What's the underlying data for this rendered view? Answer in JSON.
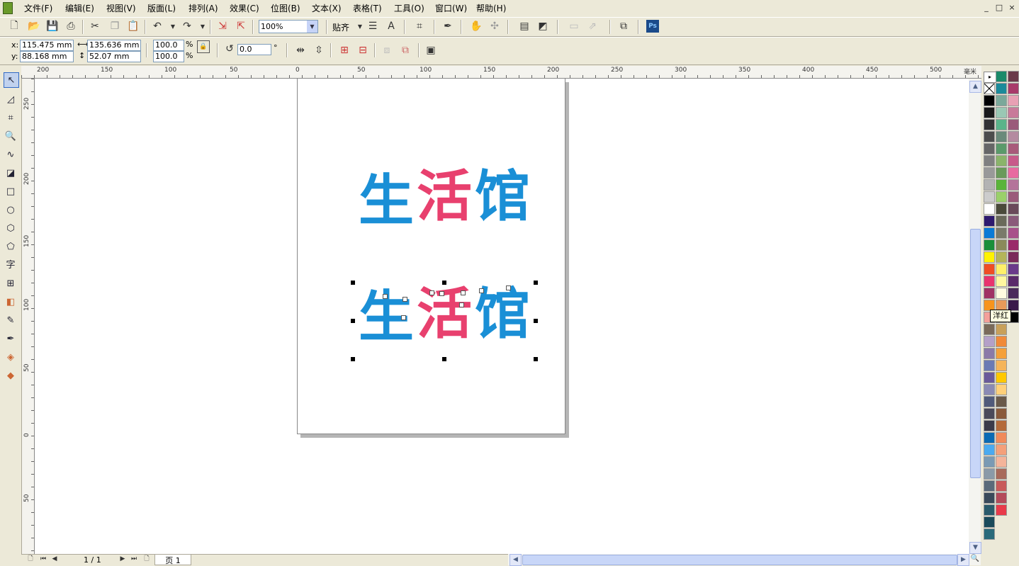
{
  "menu": [
    "文件(F)",
    "编辑(E)",
    "视图(V)",
    "版面(L)",
    "排列(A)",
    "效果(C)",
    "位图(B)",
    "文本(X)",
    "表格(T)",
    "工具(O)",
    "窗口(W)",
    "帮助(H)"
  ],
  "window_buttons": [
    "_",
    "□",
    "×"
  ],
  "standard_toolbar": {
    "zoom_value": "100%",
    "snap_label": "贴齐",
    "ps_label": "Ps"
  },
  "property_bar": {
    "x_label": "x:",
    "x_value": "115.475 mm",
    "y_label": "y:",
    "y_value": "88.168 mm",
    "width_value": "135.636 mm",
    "height_value": "52.07 mm",
    "scale_x": "100.0",
    "scale_y": "100.0",
    "percent": "%",
    "rotation": "0.0",
    "degree": "°"
  },
  "ruler": {
    "unit": "毫米",
    "h_labels": [
      "200",
      "150",
      "100",
      "50",
      "0",
      "50",
      "100",
      "150",
      "200",
      "250",
      "300",
      "350",
      "400",
      "450",
      "500"
    ],
    "v_labels": [
      "250",
      "200",
      "150",
      "100",
      "50",
      "0",
      "50"
    ]
  },
  "artwork": {
    "logo_text": "生活馆",
    "char1": "生",
    "char2": "活",
    "char3": "馆",
    "blue": "#1a8fd6",
    "pink": "#e8406e"
  },
  "page_nav": {
    "counter": "1 / 1",
    "page_tab": "页 1"
  },
  "palette": {
    "tooltip": "洋红",
    "col1": [
      "#000000",
      "#1a1a1a",
      "#333333",
      "#4d4d4d",
      "#666666",
      "#808080",
      "#999999",
      "#b3b3b3",
      "#cccccc",
      "#ffffff",
      "#2e1a6e",
      "#0a7ad6",
      "#1a8f3a",
      "#fff200",
      "#f04e23",
      "#e8346e",
      "#a03264",
      "#f7941d",
      "#f4a09a",
      "#7a6a5a",
      "#b4a0c8",
      "#8a7aa8",
      "#6a7ab4",
      "#6a5a9a",
      "#8a8ab4",
      "#505a7a",
      "#4a4a5a",
      "#3a3a4a",
      "#0a6ab4",
      "#4aaaf0",
      "#7a9ab4",
      "#8a9aa8",
      "#5a6a7a",
      "#3a4a5a",
      "#2a5a6a",
      "#1a4a5a",
      "#2a6a7a"
    ],
    "col2": [
      "#1a8a6a",
      "#1a8a9a",
      "#7aa89a",
      "#9ac8b4",
      "#5ab48a",
      "#6a8a7a",
      "#5a9a6a",
      "#8ab46a",
      "#6a9a5a",
      "#5ab43a",
      "#9ad06a",
      "#4a4a3a",
      "#6a6a5a",
      "#7a7a6a",
      "#8a8a5a",
      "#b4b45a",
      "#fff06a",
      "#fff8a0",
      "#fffce0",
      "#e89a5a",
      "#b4785a",
      "#c8a05a",
      "#f08a3a",
      "#f4a03a",
      "#f4b45a",
      "#ffc800",
      "#ffd07a",
      "#6a5a4a",
      "#8a5a3a",
      "#b46a3a",
      "#f08a5a",
      "#f4a07a",
      "#f4b49a",
      "#a86a5a",
      "#c85a5a",
      "#b44a5a",
      "#e83a4a"
    ],
    "col3": [
      "#6a3a4a",
      "#a83a6a",
      "#e8a0b4",
      "#c87a9a",
      "#9a5a7a",
      "#b48aa0",
      "#a85a7a",
      "#c85a8a",
      "#e86aa0",
      "#b4749a",
      "#9a5a7a",
      "#6a4a5a",
      "#8a5a7a",
      "#a8508a",
      "#9a2a6a",
      "#7a2a5a",
      "#6a3a8a",
      "#5a2a6a",
      "#4a2a5a",
      "#3a1a4a",
      "#000000"
    ]
  }
}
